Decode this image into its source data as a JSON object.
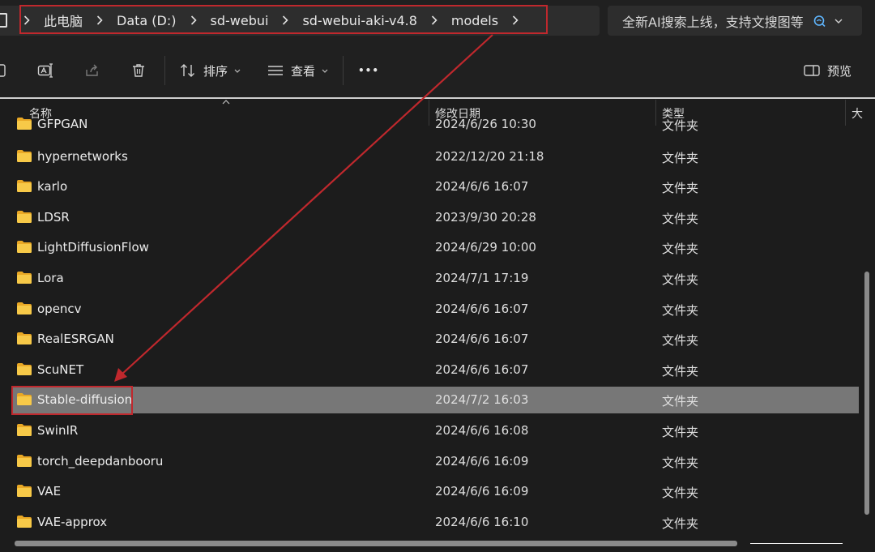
{
  "address_bar": {
    "breadcrumbs": [
      "此电脑",
      "Data (D:)",
      "sd-webui",
      "sd-webui-aki-v4.8",
      "models"
    ]
  },
  "search": {
    "placeholder": "全新AI搜索上线，支持文搜图等"
  },
  "toolbar": {
    "sort_label": "排序",
    "view_label": "查看",
    "more_label": "•••",
    "preview_label": "预览"
  },
  "columns": {
    "name": "名称",
    "modified": "修改日期",
    "type": "类型",
    "size": "大"
  },
  "files": [
    {
      "name": "GFPGAN",
      "modified": "2024/6/26 10:30",
      "type": "文件夹"
    },
    {
      "name": "hypernetworks",
      "modified": "2022/12/20 21:18",
      "type": "文件夹"
    },
    {
      "name": "karlo",
      "modified": "2024/6/6 16:07",
      "type": "文件夹"
    },
    {
      "name": "LDSR",
      "modified": "2023/9/30 20:28",
      "type": "文件夹"
    },
    {
      "name": "LightDiffusionFlow",
      "modified": "2024/6/29 10:00",
      "type": "文件夹"
    },
    {
      "name": "Lora",
      "modified": "2024/7/1 17:19",
      "type": "文件夹"
    },
    {
      "name": "opencv",
      "modified": "2024/6/6 16:07",
      "type": "文件夹"
    },
    {
      "name": "RealESRGAN",
      "modified": "2024/6/6 16:07",
      "type": "文件夹"
    },
    {
      "name": "ScuNET",
      "modified": "2024/6/6 16:07",
      "type": "文件夹"
    },
    {
      "name": "Stable-diffusion",
      "modified": "2024/7/2 16:03",
      "type": "文件夹",
      "selected": true
    },
    {
      "name": "SwinIR",
      "modified": "2024/6/6 16:08",
      "type": "文件夹"
    },
    {
      "name": "torch_deepdanbooru",
      "modified": "2024/6/6 16:09",
      "type": "文件夹"
    },
    {
      "name": "VAE",
      "modified": "2024/6/6 16:09",
      "type": "文件夹"
    },
    {
      "name": "VAE-approx",
      "modified": "2024/6/6 16:10",
      "type": "文件夹"
    }
  ],
  "colors": {
    "background": "#1c1c1c",
    "selected_row": "#777777",
    "annotation": "#c0282d",
    "folder": "#f5c242"
  },
  "icons": [
    "computer-icon",
    "chevron-right-icon",
    "search-ai-icon",
    "rename-icon",
    "share-icon",
    "delete-icon",
    "sort-icon",
    "view-icon",
    "preview-pane-icon",
    "folder-icon"
  ]
}
